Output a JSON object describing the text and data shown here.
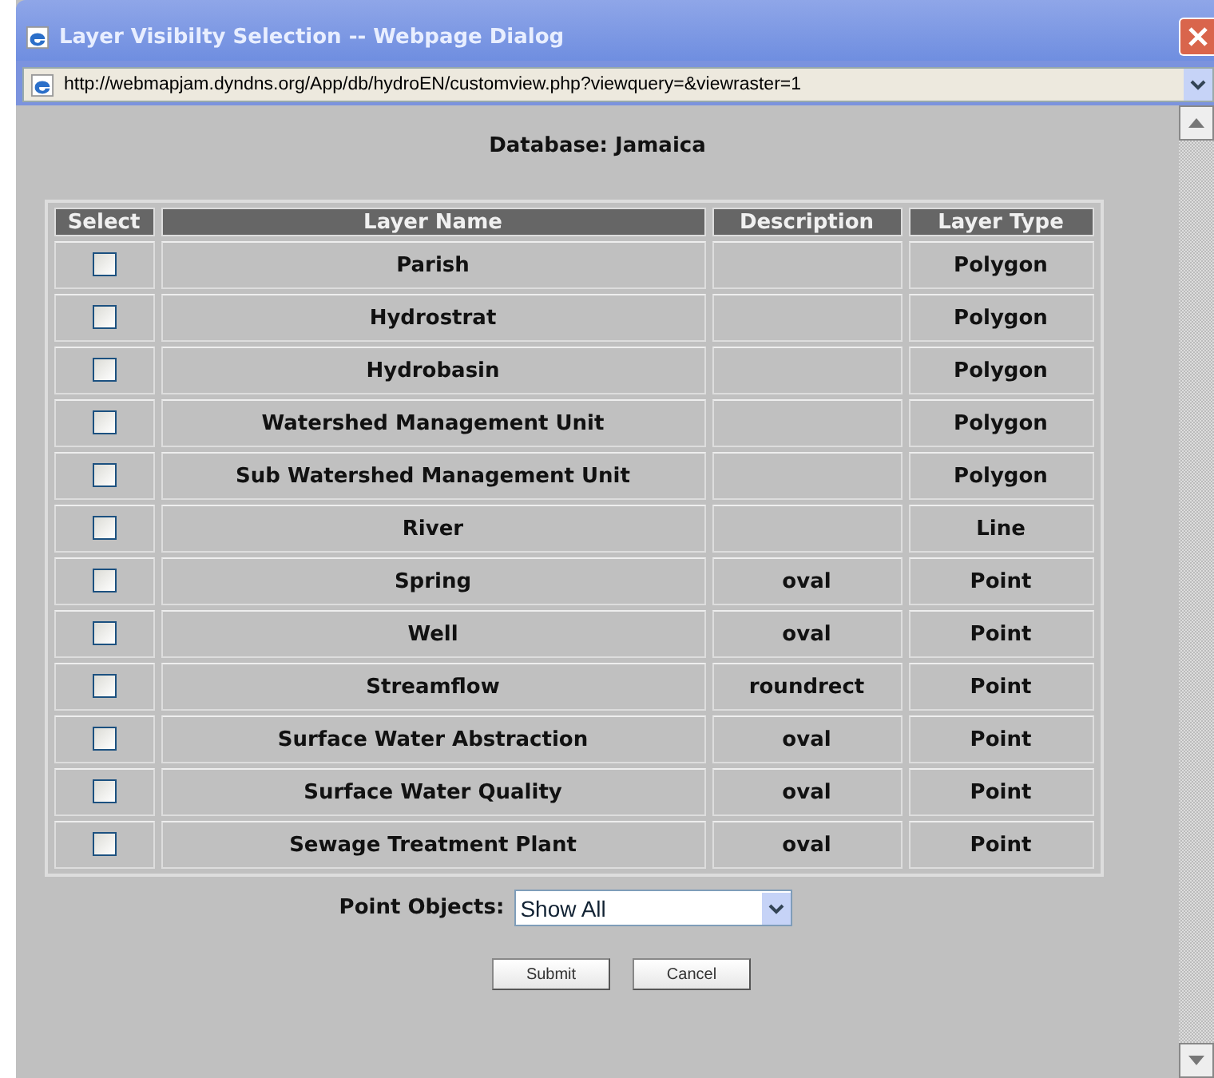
{
  "window": {
    "title": "Layer Visibilty Selection -- Webpage Dialog"
  },
  "address_bar": {
    "url": "http://webmapjam.dyndns.org/App/db/hydroEN/customview.php?viewquery=&viewraster=1"
  },
  "heading": "Database: Jamaica",
  "table": {
    "columns": [
      "Select",
      "Layer Name",
      "Description",
      "Layer Type"
    ],
    "rows": [
      {
        "checked": false,
        "name": "Parish",
        "description": "",
        "type": "Polygon"
      },
      {
        "checked": false,
        "name": "Hydrostrat",
        "description": "",
        "type": "Polygon"
      },
      {
        "checked": false,
        "name": "Hydrobasin",
        "description": "",
        "type": "Polygon"
      },
      {
        "checked": false,
        "name": "Watershed Management Unit",
        "description": "",
        "type": "Polygon"
      },
      {
        "checked": false,
        "name": "Sub Watershed Management Unit",
        "description": "",
        "type": "Polygon"
      },
      {
        "checked": false,
        "name": "River",
        "description": "",
        "type": "Line"
      },
      {
        "checked": false,
        "name": "Spring",
        "description": "oval",
        "type": "Point"
      },
      {
        "checked": false,
        "name": "Well",
        "description": "oval",
        "type": "Point"
      },
      {
        "checked": false,
        "name": "Streamflow",
        "description": "roundrect",
        "type": "Point"
      },
      {
        "checked": false,
        "name": "Surface Water Abstraction",
        "description": "oval",
        "type": "Point"
      },
      {
        "checked": false,
        "name": "Surface Water Quality",
        "description": "oval",
        "type": "Point"
      },
      {
        "checked": false,
        "name": "Sewage Treatment Plant",
        "description": "oval",
        "type": "Point"
      }
    ]
  },
  "point_objects": {
    "label": "Point Objects:",
    "value": "Show All"
  },
  "buttons": [
    "Submit",
    "Cancel"
  ]
}
